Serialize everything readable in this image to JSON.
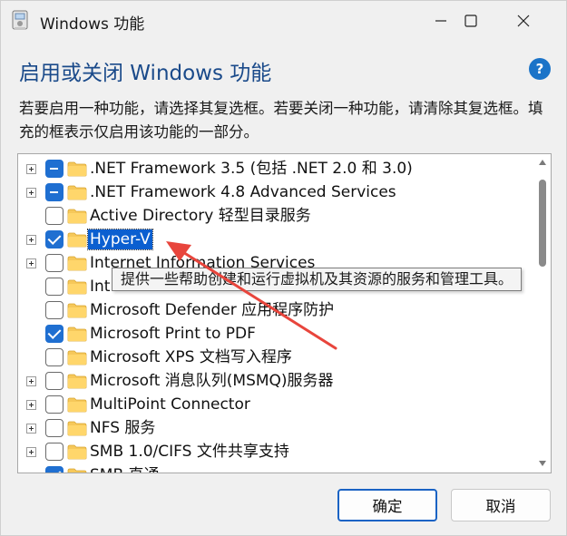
{
  "window": {
    "title": "Windows 功能",
    "heading": "启用或关闭 Windows 功能",
    "description": "若要启用一种功能，请选择其复选框。若要关闭一种功能，请清除其复选框。填充的框表示仅启用该功能的一部分。",
    "help_glyph": "?"
  },
  "features": [
    {
      "label": ".NET Framework 3.5 (包括 .NET 2.0 和 3.0)",
      "expandable": true,
      "state": "partial"
    },
    {
      "label": ".NET Framework 4.8 Advanced Services",
      "expandable": true,
      "state": "partial"
    },
    {
      "label": "Active Directory 轻型目录服务",
      "expandable": false,
      "state": "unchecked"
    },
    {
      "label": "Hyper-V",
      "expandable": true,
      "state": "checked",
      "selected": true
    },
    {
      "label": "Internet Information Services",
      "expandable": true,
      "state": "unchecked"
    },
    {
      "label": "Int",
      "expandable": false,
      "state": "unchecked"
    },
    {
      "label": "Microsoft Defender 应用程序防护",
      "expandable": false,
      "state": "unchecked"
    },
    {
      "label": "Microsoft Print to PDF",
      "expandable": false,
      "state": "checked"
    },
    {
      "label": "Microsoft XPS 文档写入程序",
      "expandable": false,
      "state": "unchecked"
    },
    {
      "label": "Microsoft 消息队列(MSMQ)服务器",
      "expandable": true,
      "state": "unchecked"
    },
    {
      "label": "MultiPoint Connector",
      "expandable": true,
      "state": "unchecked"
    },
    {
      "label": "NFS 服务",
      "expandable": true,
      "state": "unchecked"
    },
    {
      "label": "SMB 1.0/CIFS 文件共享支持",
      "expandable": true,
      "state": "unchecked"
    },
    {
      "label": "SMB 直通",
      "expandable": false,
      "state": "checked"
    }
  ],
  "tooltip": "提供一些帮助创建和运行虚拟机及其资源的服务和管理工具。",
  "buttons": {
    "ok": "确定",
    "cancel": "取消"
  },
  "colors": {
    "accent": "#1f6fd1",
    "selection": "#0b5fd0",
    "heading": "#1a4a8a",
    "annotation_arrow": "#e8453c",
    "folder": "#f6c85a"
  }
}
